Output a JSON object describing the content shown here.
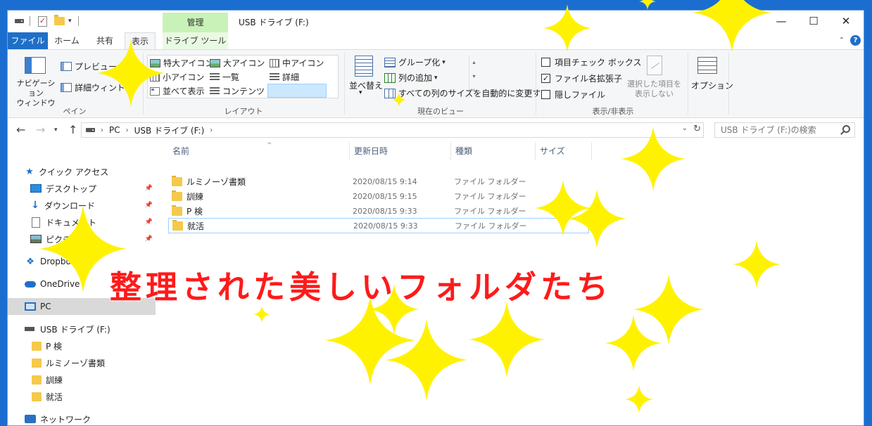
{
  "titlebar": {
    "contextual_tab_header": "管理",
    "title": "USB ドライブ (F:)",
    "minimize_glyph": "—",
    "maximize_glyph": "☐",
    "close_glyph": "✕"
  },
  "tabs": {
    "file": "ファイル",
    "home": "ホーム",
    "share": "共有",
    "view": "表示",
    "drive_tools": "ドライブ ツール"
  },
  "ribbon": {
    "pane": {
      "nav_pane": "ナビゲーション\nウィンドウ",
      "preview": "プレビュー ウィンドウ",
      "details": "詳細ウィンドウ",
      "group_label": "ペイン"
    },
    "layout": {
      "extra_large": "特大アイコン",
      "large": "大アイコン",
      "medium": "中アイコン",
      "small": "小アイコン",
      "list": "一覧",
      "details": "詳細",
      "tiles": "並べて表示",
      "content": "コンテンツ",
      "group_label": "レイアウト"
    },
    "current_view": {
      "sort": "並べ替え",
      "group_by": "グループ化",
      "add_column": "列の追加",
      "fit_columns": "すべての列のサイズを自動的に変更する",
      "group_label": "現在のビュー"
    },
    "show_hide": {
      "item_checkboxes": "項目チェック ボックス",
      "file_extensions": "ファイル名拡張子",
      "hidden_items": "隠しファイル",
      "hide_selected": "選択した項目を\n表示しない",
      "group_label": "表示/非表示",
      "file_extensions_checked": true
    },
    "options": "オプション"
  },
  "address": {
    "crumbs": [
      "PC",
      "USB ドライブ (F:)"
    ],
    "search_placeholder": "USB ドライブ (F:)の検索"
  },
  "navpane": {
    "quick_access": "クイック アクセス",
    "desktop": "デスクトップ",
    "downloads": "ダウンロード",
    "documents": "ドキュメント",
    "pictures": "ピクチャ",
    "dropbox": "Dropbox",
    "onedrive": "OneDrive",
    "pc": "PC",
    "usb": "USB ドライブ (F:)",
    "usb_children": [
      "P 検",
      "ルミノーゾ書類",
      "訓練",
      "就活"
    ],
    "network": "ネットワーク"
  },
  "filelist": {
    "columns": {
      "name": "名前",
      "modified": "更新日時",
      "type": "種類",
      "size": "サイズ"
    },
    "rows": [
      {
        "name": "ルミノーゾ書類",
        "modified": "2020/08/15 9:14",
        "type": "ファイル フォルダー"
      },
      {
        "name": "訓練",
        "modified": "2020/08/15 9:15",
        "type": "ファイル フォルダー"
      },
      {
        "name": "P 検",
        "modified": "2020/08/15 9:33",
        "type": "ファイル フォルダー"
      },
      {
        "name": "就活",
        "modified": "2020/08/15 9:33",
        "type": "ファイル フォルダー"
      }
    ]
  },
  "overlay": {
    "caption": "整理された美しいフォルダたち",
    "caption_color": "#ff1a1a",
    "sparkle_color": "#fff200"
  },
  "colors": {
    "file_tab": "#1e6fc8",
    "contextual_tab": "#c9f2b8",
    "folder": "#f5c94a",
    "selection": "#cce8ff"
  }
}
